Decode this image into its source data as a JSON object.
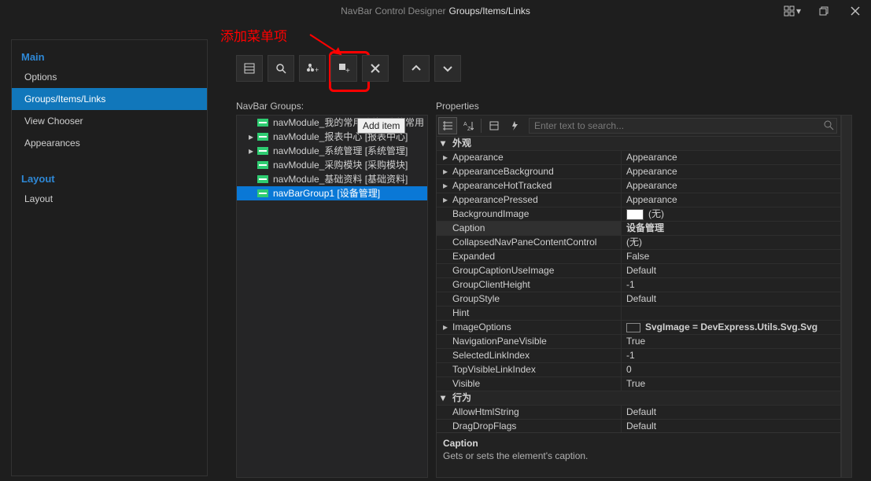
{
  "window": {
    "title_left": "NavBar Control Designer",
    "title_right": "Groups/Items/Links"
  },
  "annotation": {
    "label": "添加菜单项"
  },
  "tooltip": "Add item",
  "sidebar": {
    "main_header": "Main",
    "options": "Options",
    "groups": "Groups/Items/Links",
    "viewchooser": "View Chooser",
    "appearances": "Appearances",
    "layout_header": "Layout",
    "layout": "Layout"
  },
  "groups_label": "NavBar Groups:",
  "tree": [
    {
      "label": "navModule_我的常用功能 [我的常用",
      "expandable": false
    },
    {
      "label": "navModule_报表中心 [报表中心]",
      "expandable": true
    },
    {
      "label": "navModule_系统管理 [系统管理]",
      "expandable": true
    },
    {
      "label": "navModule_采购模块 [采购模块]",
      "expandable": false
    },
    {
      "label": "navModule_基础资料 [基础资料]",
      "expandable": false
    },
    {
      "label": "navBarGroup1 [设备管理]",
      "expandable": false,
      "selected": true
    }
  ],
  "properties_label": "Properties",
  "search_placeholder": "Enter text to search...",
  "categories": {
    "appearance_cat": "外观",
    "behavior_cat": "行为"
  },
  "props": {
    "Appearance": {
      "name": "Appearance",
      "value": "Appearance",
      "exp": true
    },
    "AppearanceBackground": {
      "name": "AppearanceBackground",
      "value": "Appearance",
      "exp": true
    },
    "AppearanceHotTracked": {
      "name": "AppearanceHotTracked",
      "value": "Appearance",
      "exp": true
    },
    "AppearancePressed": {
      "name": "AppearancePressed",
      "value": "Appearance",
      "exp": true
    },
    "BackgroundImage": {
      "name": "BackgroundImage",
      "value": "(无)"
    },
    "Caption": {
      "name": "Caption",
      "value": "设备管理"
    },
    "CollapsedNavPaneContentControl": {
      "name": "CollapsedNavPaneContentControl",
      "value": "(无)"
    },
    "Expanded": {
      "name": "Expanded",
      "value": "False"
    },
    "GroupCaptionUseImage": {
      "name": "GroupCaptionUseImage",
      "value": "Default"
    },
    "GroupClientHeight": {
      "name": "GroupClientHeight",
      "value": "-1"
    },
    "GroupStyle": {
      "name": "GroupStyle",
      "value": "Default"
    },
    "Hint": {
      "name": "Hint",
      "value": ""
    },
    "ImageOptions": {
      "name": "ImageOptions",
      "value": "SvgImage = DevExpress.Utils.Svg.Svg",
      "exp": true
    },
    "NavigationPaneVisible": {
      "name": "NavigationPaneVisible",
      "value": "True"
    },
    "SelectedLinkIndex": {
      "name": "SelectedLinkIndex",
      "value": "-1"
    },
    "TopVisibleLinkIndex": {
      "name": "TopVisibleLinkIndex",
      "value": "0"
    },
    "Visible": {
      "name": "Visible",
      "value": "True"
    },
    "AllowHtmlString": {
      "name": "AllowHtmlString",
      "value": "Default"
    },
    "DragDropFlags": {
      "name": "DragDropFlags",
      "value": "Default"
    }
  },
  "desc": {
    "title": "Caption",
    "text": "Gets or sets the element's caption."
  }
}
